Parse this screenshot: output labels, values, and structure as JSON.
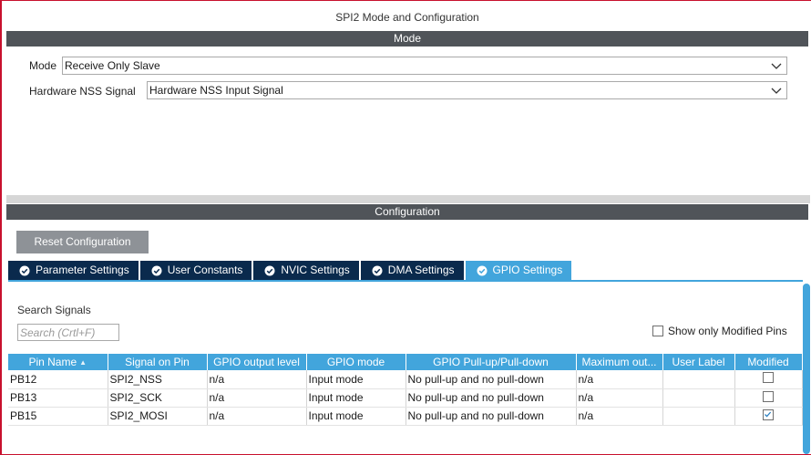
{
  "window_title": "SPI2 Mode and Configuration",
  "mode_section": {
    "title": "Mode",
    "mode_label": "Mode",
    "mode_value": "Receive Only Slave",
    "nss_label": "Hardware NSS Signal",
    "nss_value": "Hardware NSS Input Signal"
  },
  "config_section": {
    "title": "Configuration",
    "reset_label": "Reset Configuration",
    "tabs": [
      {
        "label": "Parameter Settings",
        "active": false
      },
      {
        "label": "User Constants",
        "active": false
      },
      {
        "label": "NVIC Settings",
        "active": false
      },
      {
        "label": "DMA Settings",
        "active": false
      },
      {
        "label": "GPIO Settings",
        "active": true
      }
    ]
  },
  "gpio": {
    "search_label": "Search Signals",
    "search_placeholder": "Search (Crtl+F)",
    "search_value": "",
    "show_modified_label": "Show only Modified Pins",
    "show_modified_checked": false,
    "columns": [
      "Pin Name",
      "Signal on Pin",
      "GPIO output level",
      "GPIO mode",
      "GPIO Pull-up/Pull-down",
      "Maximum out...",
      "User Label",
      "Modified"
    ],
    "rows": [
      {
        "pin": "PB12",
        "signal": "SPI2_NSS",
        "output_level": "n/a",
        "mode": "Input mode",
        "pull": "No pull-up and no pull-down",
        "max_speed": "n/a",
        "user_label": "",
        "modified": false
      },
      {
        "pin": "PB13",
        "signal": "SPI2_SCK",
        "output_level": "n/a",
        "mode": "Input mode",
        "pull": "No pull-up and no pull-down",
        "max_speed": "n/a",
        "user_label": "",
        "modified": false
      },
      {
        "pin": "PB15",
        "signal": "SPI2_MOSI",
        "output_level": "n/a",
        "mode": "Input mode",
        "pull": "No pull-up and no pull-down",
        "max_speed": "n/a",
        "user_label": "",
        "modified": true
      }
    ]
  },
  "icons": {
    "tab_check": "check-circle-icon",
    "dropdown": "chevron-down-icon",
    "sort": "sort-ascending-icon"
  },
  "colors": {
    "section_bar": "#505459",
    "tab_inactive": "#0a2a4d",
    "tab_active": "#42a5dc",
    "table_header": "#42a5dc",
    "reset_button": "#8e9297",
    "window_border": "#c8102e"
  }
}
